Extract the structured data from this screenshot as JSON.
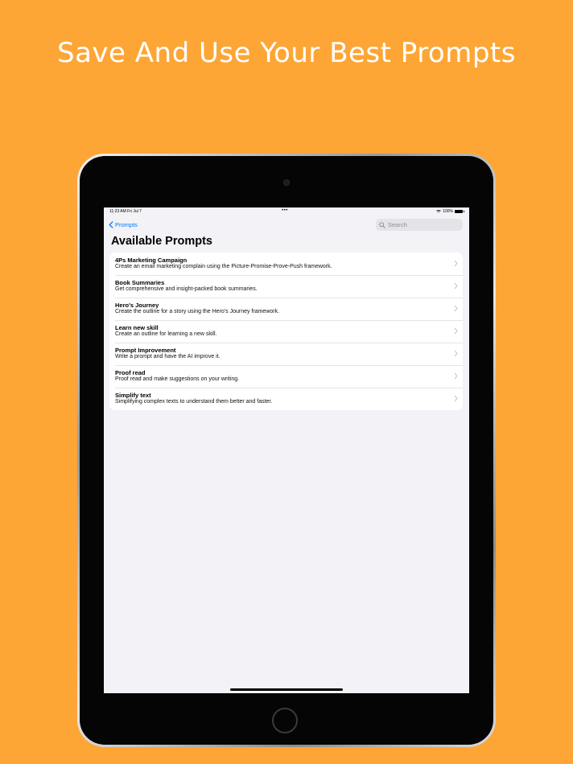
{
  "headline": "Save And Use Your Best Prompts",
  "status_bar": {
    "time": "11:23 AM  Fri Jul 7",
    "dots": "•••",
    "battery": "100%"
  },
  "nav": {
    "back_label": "Prompts",
    "search_placeholder": "Search"
  },
  "page_title": "Available Prompts",
  "prompts": [
    {
      "title": "4Ps Marketing Campaign",
      "description": "Create an email marketing complain using the Picture-Promise-Prove-Push framework."
    },
    {
      "title": "Book Summaries",
      "description": "Get comprehensive and insight-packed book summaries."
    },
    {
      "title": "Hero's Journey",
      "description": "Create the outline for a story using the Hero's Journey framework."
    },
    {
      "title": "Learn new skill",
      "description": "Create an outline for learning a new skill."
    },
    {
      "title": "Prompt Improvement",
      "description": "Write a prompt and have the AI improve it."
    },
    {
      "title": "Proof read",
      "description": "Proof read and make suggestions on your writing."
    },
    {
      "title": "Simplify text",
      "description": "Simplifying complex texts to understand them better and faster."
    }
  ],
  "colors": {
    "background": "#FDA636",
    "accent": "#007AFF"
  }
}
